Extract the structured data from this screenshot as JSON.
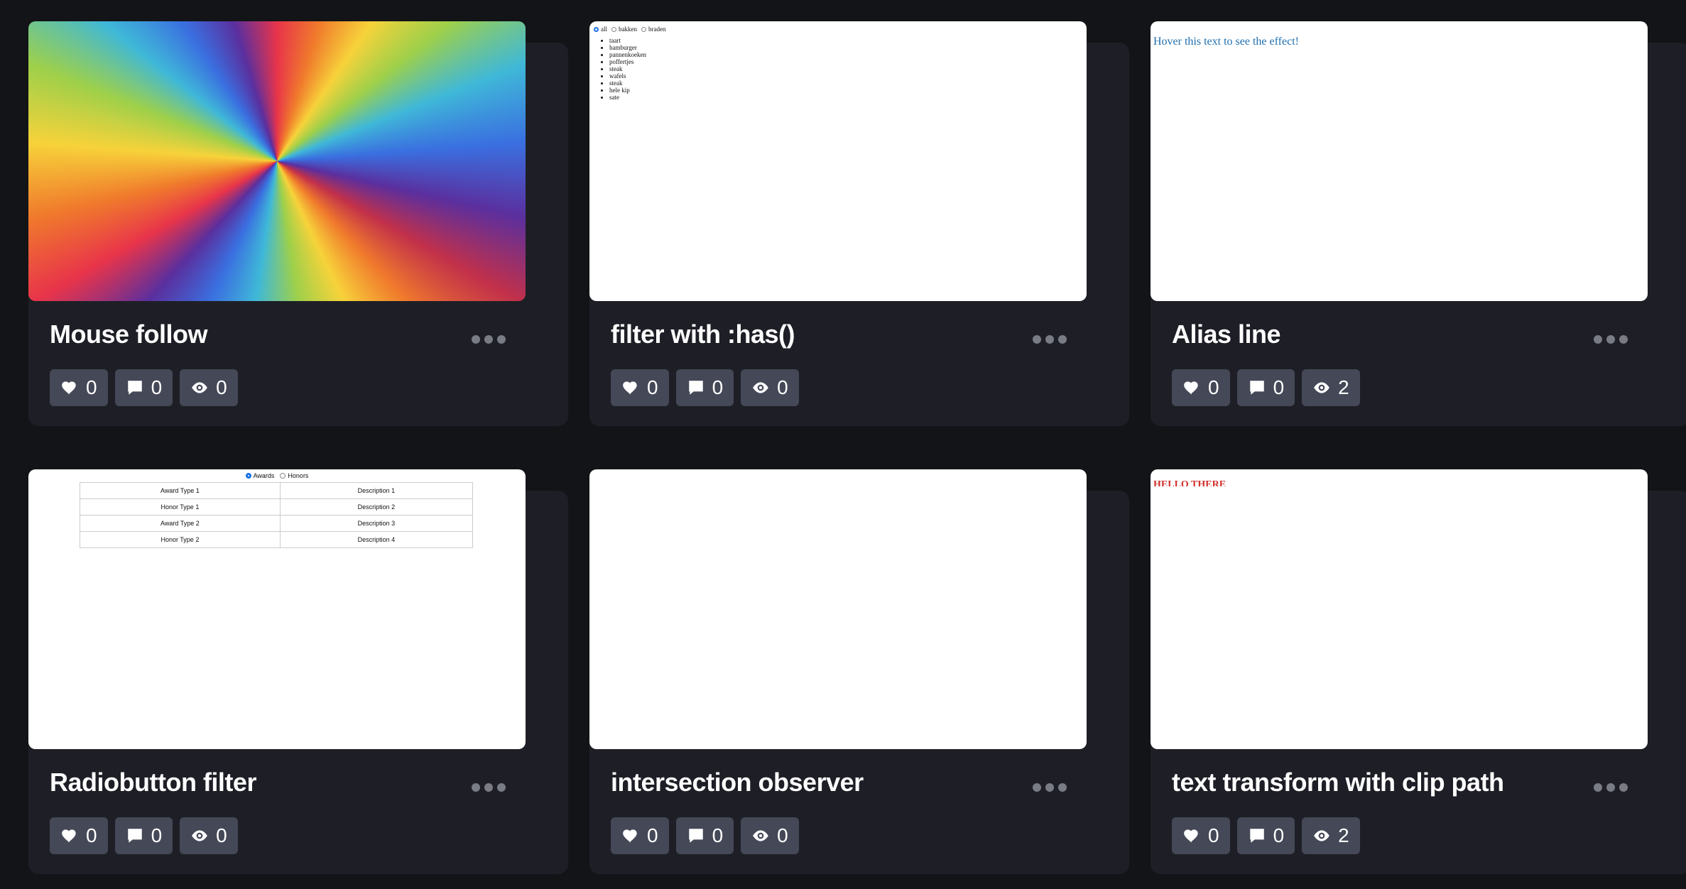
{
  "cards": [
    {
      "title": "Mouse follow",
      "more_icon": "ellipsis-icon",
      "stats": {
        "likes": "0",
        "comments": "0",
        "views": "0"
      },
      "preview": {
        "type": "rainbow-conic-gradient"
      }
    },
    {
      "title": "filter with :has()",
      "more_icon": "ellipsis-icon",
      "stats": {
        "likes": "0",
        "comments": "0",
        "views": "0"
      },
      "preview": {
        "radios": [
          "all",
          "bakken",
          "braden"
        ],
        "selected": "all",
        "items": [
          "taart",
          "hamburger",
          "pannenkoeken",
          "poffertjes",
          "steak",
          "wafels",
          "steak",
          "hele kip",
          "sate"
        ]
      }
    },
    {
      "title": "Alias line",
      "more_icon": "ellipsis-icon",
      "stats": {
        "likes": "0",
        "comments": "0",
        "views": "2"
      },
      "preview": {
        "text": "Hover this text to see the effect!"
      }
    },
    {
      "title": "Radiobutton filter",
      "more_icon": "ellipsis-icon",
      "stats": {
        "likes": "0",
        "comments": "0",
        "views": "0"
      },
      "preview": {
        "radios": [
          "Awards",
          "Honors"
        ],
        "selected": "Awards",
        "rows": [
          [
            "Award Type 1",
            "Description 1"
          ],
          [
            "Honor Type 1",
            "Description 2"
          ],
          [
            "Award Type 2",
            "Description 3"
          ],
          [
            "Honor Type 2",
            "Description 4"
          ]
        ]
      }
    },
    {
      "title": "intersection observer",
      "more_icon": "ellipsis-icon",
      "stats": {
        "likes": "0",
        "comments": "0",
        "views": "0"
      },
      "preview": {
        "type": "blank"
      }
    },
    {
      "title": "text transform with clip path",
      "more_icon": "ellipsis-icon",
      "stats": {
        "likes": "0",
        "comments": "0",
        "views": "2"
      },
      "preview": {
        "text": "HELLO THERE"
      }
    }
  ],
  "icons": {
    "like": "heart-icon",
    "comment": "comment-icon",
    "view": "eye-icon"
  }
}
